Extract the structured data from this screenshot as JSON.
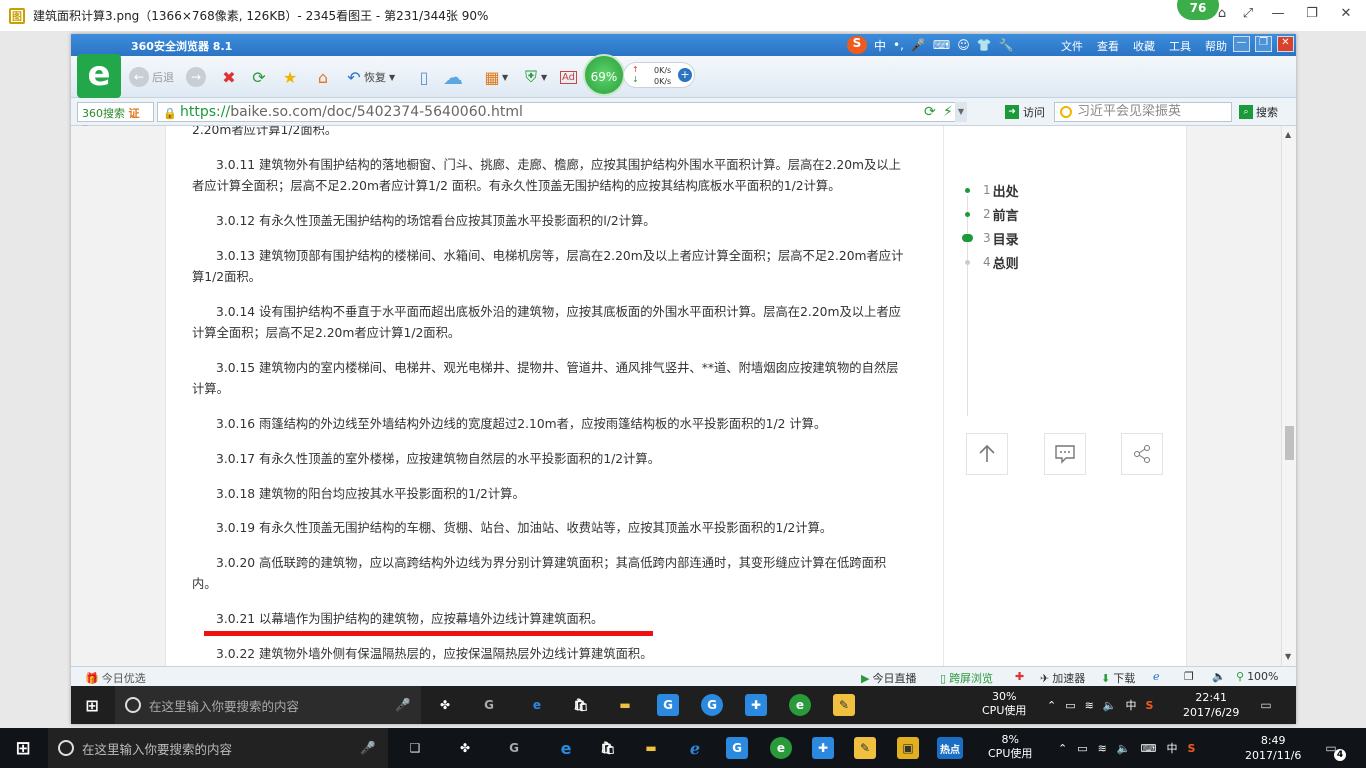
{
  "outer_window": {
    "title": "建筑面积计算3.png（1366×768像素, 126KB）- 2345看图王 - 第231/344张 90%",
    "badge": "76"
  },
  "browser": {
    "name": "360安全浏览器 8.1",
    "menu": [
      "文件",
      "查看",
      "收藏",
      "工具",
      "帮助"
    ],
    "ime": {
      "zh": "中",
      "punct": "•,"
    },
    "toolbar": {
      "back": "后退",
      "restore": "恢复",
      "ad": "Ad"
    },
    "speed": {
      "percent": "69%",
      "up": "0K/s",
      "down": "0K/s"
    },
    "search_engine": "360搜索",
    "search_badge": "证",
    "url_scheme": "https://",
    "url_rest": "baike.so.com/doc/5402374-5640060.html",
    "visit_label": "访问",
    "search_placeholder": "习近平会见梁振英",
    "search_label": "搜索"
  },
  "article": {
    "paragraphs": [
      {
        "text": "2.20m者应计算1/2面积。",
        "indent": false
      },
      {
        "text": "3.0.11 建筑物外有围护结构的落地橱窗、门斗、挑廊、走廊、檐廊，应按其围护结构外围水平面积计算。层高在2.20m及以上者应计算全面积；层高不足2.20m者应计算1/2 面积。有永久性顶盖无围护结构的应按其结构底板水平面积的1/2计算。",
        "indent": true
      },
      {
        "text": "3.0.12 有永久性顶盖无围护结构的场馆看台应按其顶盖水平投影面积的l/2计算。",
        "indent": true
      },
      {
        "text": "3.0.13 建筑物顶部有围护结构的楼梯间、水箱间、电梯机房等，层高在2.20m及以上者应计算全面积；层高不足2.20m者应计算1/2面积。",
        "indent": true
      },
      {
        "text": "3.0.14 设有围护结构不垂直于水平面而超出底板外沿的建筑物，应按其底板面的外围水平面积计算。层高在2.20m及以上者应计算全面积；层高不足2.20m者应计算1/2面积。",
        "indent": true
      },
      {
        "text": "3.0.15 建筑物内的室内楼梯间、电梯井、观光电梯井、提物井、管道井、通风排气竖井、**道、附墙烟囱应按建筑物的自然层计算。",
        "indent": true
      },
      {
        "text": "3.0.16 雨篷结构的外边线至外墙结构外边线的宽度超过2.10m者，应按雨篷结构板的水平投影面积的1/2 计算。",
        "indent": true
      },
      {
        "text": "3.0.17 有永久性顶盖的室外楼梯，应按建筑物自然层的水平投影面积的1/2计算。",
        "indent": true
      },
      {
        "text": "3.0.18 建筑物的阳台均应按其水平投影面积的1/2计算。",
        "indent": true
      },
      {
        "text": "3.0.19 有永久性顶盖无围护结构的车棚、货棚、站台、加油站、收费站等，应按其顶盖水平投影面积的1/2计算。",
        "indent": true
      },
      {
        "text": "3.0.20 高低联跨的建筑物，应以高跨结构外边线为界分别计算建筑面积；其高低跨内部连通时，其变形缝应计算在低跨面积内。",
        "indent": true
      },
      {
        "text": "3.0.21 以幕墙作为围护结构的建筑物，应按幕墙外边线计算建筑面积。",
        "indent": true
      },
      {
        "text": "3.0.22 建筑物外墙外侧有保温隔热层的，应按保温隔热层外边线计算建筑面积。",
        "indent": true
      }
    ]
  },
  "toc": [
    {
      "num": "1",
      "label": "出处",
      "state": "done"
    },
    {
      "num": "2",
      "label": "前言",
      "state": "done"
    },
    {
      "num": "3",
      "label": "目录",
      "state": "active"
    },
    {
      "num": "4",
      "label": "总则",
      "state": "pending"
    }
  ],
  "status_bar": {
    "left": "今日优选",
    "live": "今日直播",
    "split": "跨屏浏览",
    "accel": "加速器",
    "download": "下载",
    "zoom": "100%"
  },
  "inner_taskbar": {
    "search_placeholder": "在这里输入你要搜索的内容",
    "cpu_value": "30%",
    "cpu_label": "CPU使用",
    "ime": "中",
    "time": "22:41",
    "date": "2017/6/29"
  },
  "outer_taskbar": {
    "search_placeholder": "在这里输入你要搜索的内容",
    "hot_label": "热点",
    "cpu_value": "8%",
    "cpu_label": "CPU使用",
    "ime": "中",
    "time": "8:49",
    "date": "2017/11/6",
    "notifications": "4"
  },
  "colors": {
    "brand_green": "#1a9a3a",
    "title_blue": "#2b74c4",
    "underline_red": "#ee1111"
  }
}
